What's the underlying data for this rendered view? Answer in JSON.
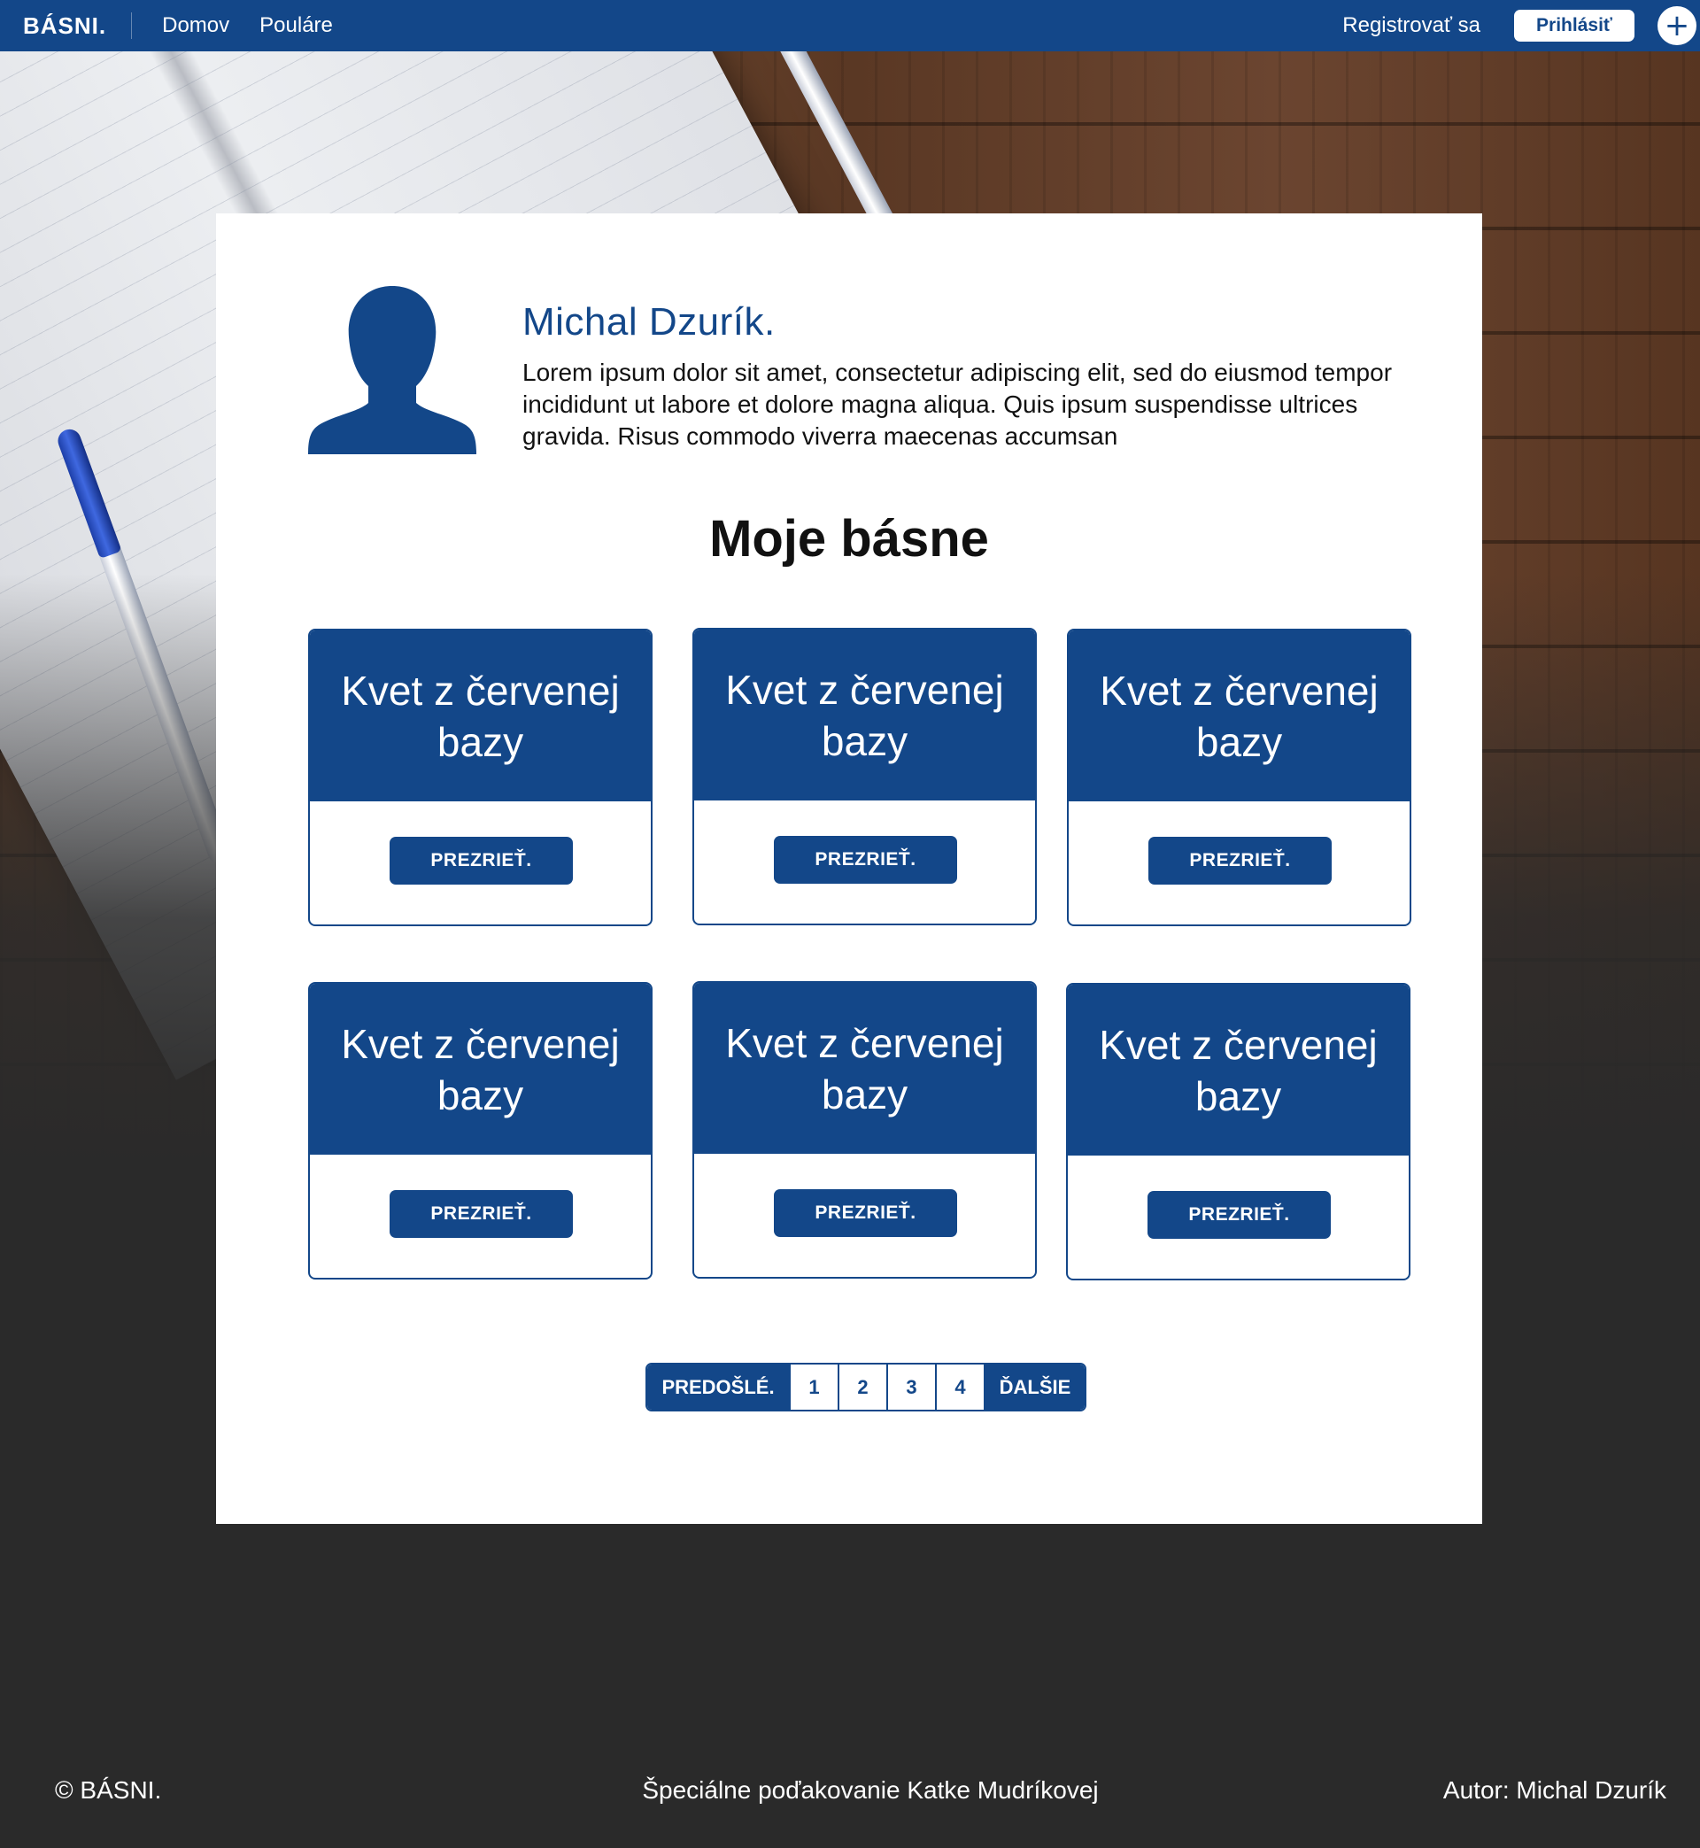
{
  "nav": {
    "brand": "BÁSNI.",
    "links": [
      "Domov",
      "Pouláre"
    ],
    "register": "Registrovať sa",
    "login": "Prihlásiť",
    "add_icon": "+"
  },
  "profile": {
    "name": "Michal Dzurík.",
    "bio": "Lorem ipsum dolor sit amet, consectetur adipiscing elit, sed do eiusmod tempor incididunt ut labore et dolore magna aliqua. Quis ipsum suspendisse ultrices gravida. Risus commodo viverra maecenas accumsan"
  },
  "section_title": "Moje básne",
  "poems": [
    {
      "title": "Kvet z červenej bazy",
      "button": "PREZRIEŤ."
    },
    {
      "title": "Kvet z červenej bazy",
      "button": "PREZRIEŤ."
    },
    {
      "title": "Kvet z červenej bazy",
      "button": "PREZRIEŤ."
    },
    {
      "title": "Kvet z červenej bazy",
      "button": "PREZRIEŤ."
    },
    {
      "title": "Kvet z červenej bazy",
      "button": "PREZRIEŤ."
    },
    {
      "title": "Kvet z červenej bazy",
      "button": "PREZRIEŤ."
    }
  ],
  "pagination": {
    "prev": "PREDOŠLÉ.",
    "pages": [
      "1",
      "2",
      "3",
      "4"
    ],
    "next": "ĎALŠIE"
  },
  "footer": {
    "copyright": "© BÁSNI.",
    "thanks": "Špeciálne poďakovanie Katke Mudríkovej",
    "author": "Autor: Michal Dzurík"
  },
  "colors": {
    "brand_blue": "#134789",
    "footer_bg": "#2a2a2a"
  },
  "icons": {
    "avatar": "person-silhouette-icon",
    "add": "plus-icon"
  }
}
